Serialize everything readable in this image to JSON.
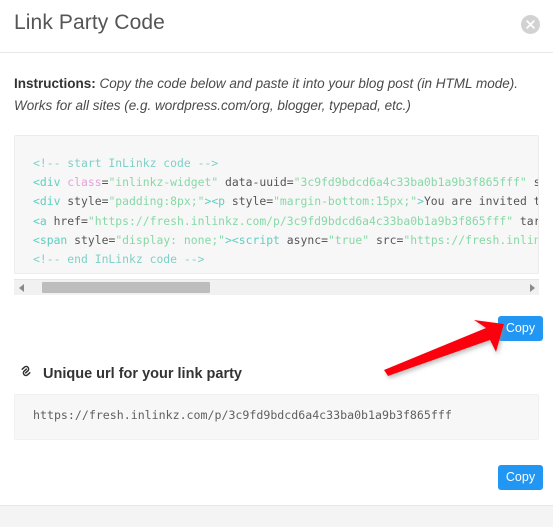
{
  "header": {
    "title": "Link Party Code",
    "close_icon": "close-icon"
  },
  "instructions": {
    "label": "Instructions:",
    "text_line1": " Copy the code below and paste it into your blog post (in HTML mode).",
    "text_line2": "Works for all sites (e.g. wordpress.com/org, blogger, typepad, etc.)"
  },
  "code_block": {
    "uuid": "3c9fd9bdcd6a4c33ba0b1a9b3f865fff",
    "lines": [
      [
        {
          "t": "comment",
          "s": "<!-- start InLinkz code -->"
        }
      ],
      [
        {
          "t": "tag",
          "s": "<div "
        },
        {
          "t": "attr",
          "s": "class"
        },
        {
          "t": "plain",
          "s": "="
        },
        {
          "t": "val",
          "s": "\"inlinkz-widget\""
        },
        {
          "t": "plain",
          "s": " data-uuid="
        },
        {
          "t": "val",
          "s": "\"3c9fd9bdcd6a4c33ba0b1a9b3f865fff\""
        },
        {
          "t": "plain",
          "s": " st"
        }
      ],
      [
        {
          "t": "tag",
          "s": "<div "
        },
        {
          "t": "plain",
          "s": "style="
        },
        {
          "t": "val",
          "s": "\"padding:8px;\""
        },
        {
          "t": "tag",
          "s": "><p "
        },
        {
          "t": "plain",
          "s": "style="
        },
        {
          "t": "val",
          "s": "\"margin-bottom:15px;\""
        },
        {
          "t": "tag",
          "s": ">"
        },
        {
          "t": "plain",
          "s": "You are invited to"
        }
      ],
      [
        {
          "t": "tag",
          "s": "<a "
        },
        {
          "t": "plain",
          "s": "href="
        },
        {
          "t": "val",
          "s": "\"https://fresh.inlinkz.com/p/3c9fd9bdcd6a4c33ba0b1a9b3f865fff\""
        },
        {
          "t": "plain",
          "s": " targ"
        }
      ],
      [
        {
          "t": "tag",
          "s": "<span "
        },
        {
          "t": "plain",
          "s": "style="
        },
        {
          "t": "val",
          "s": "\"display: none;\""
        },
        {
          "t": "tag",
          "s": "><script "
        },
        {
          "t": "plain",
          "s": "async="
        },
        {
          "t": "val",
          "s": "\"true\""
        },
        {
          "t": "plain",
          "s": " src="
        },
        {
          "t": "val",
          "s": "\"https://fresh.inlink"
        }
      ],
      [
        {
          "t": "comment",
          "s": "<!-- end InLinkz code -->"
        }
      ]
    ]
  },
  "scrollbar": {
    "left_arrow_icon": "triangle-left-icon",
    "right_arrow_icon": "triangle-right-icon"
  },
  "buttons": {
    "copy_top": "Copy",
    "copy_bottom": "Copy",
    "accent_color": "#2196f3"
  },
  "annotation": {
    "arrow_icon": "red-arrow-icon",
    "arrow_color": "#fb0007"
  },
  "unique_url": {
    "icon": "link-icon",
    "heading": "Unique url for your link party",
    "url": "https://fresh.inlinkz.com/p/3c9fd9bdcd6a4c33ba0b1a9b3f865fff"
  }
}
